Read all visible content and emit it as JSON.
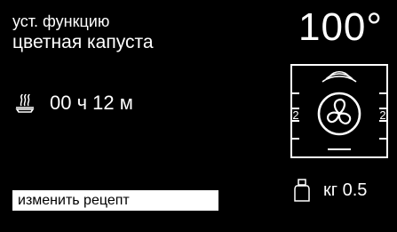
{
  "header": {
    "function_label": "уст. функцию",
    "recipe_name": "цветная капуста"
  },
  "temperature": {
    "value": "100°"
  },
  "timer": {
    "icon": "steam-dish-icon",
    "time": "00 ч 12 м"
  },
  "oven": {
    "icon": "fan-convection-icon",
    "left_level": "2",
    "right_level": "2"
  },
  "actions": {
    "change_recipe_label": "изменить рецепт"
  },
  "weight": {
    "icon": "weight-icon",
    "value": "кг 0.5"
  }
}
